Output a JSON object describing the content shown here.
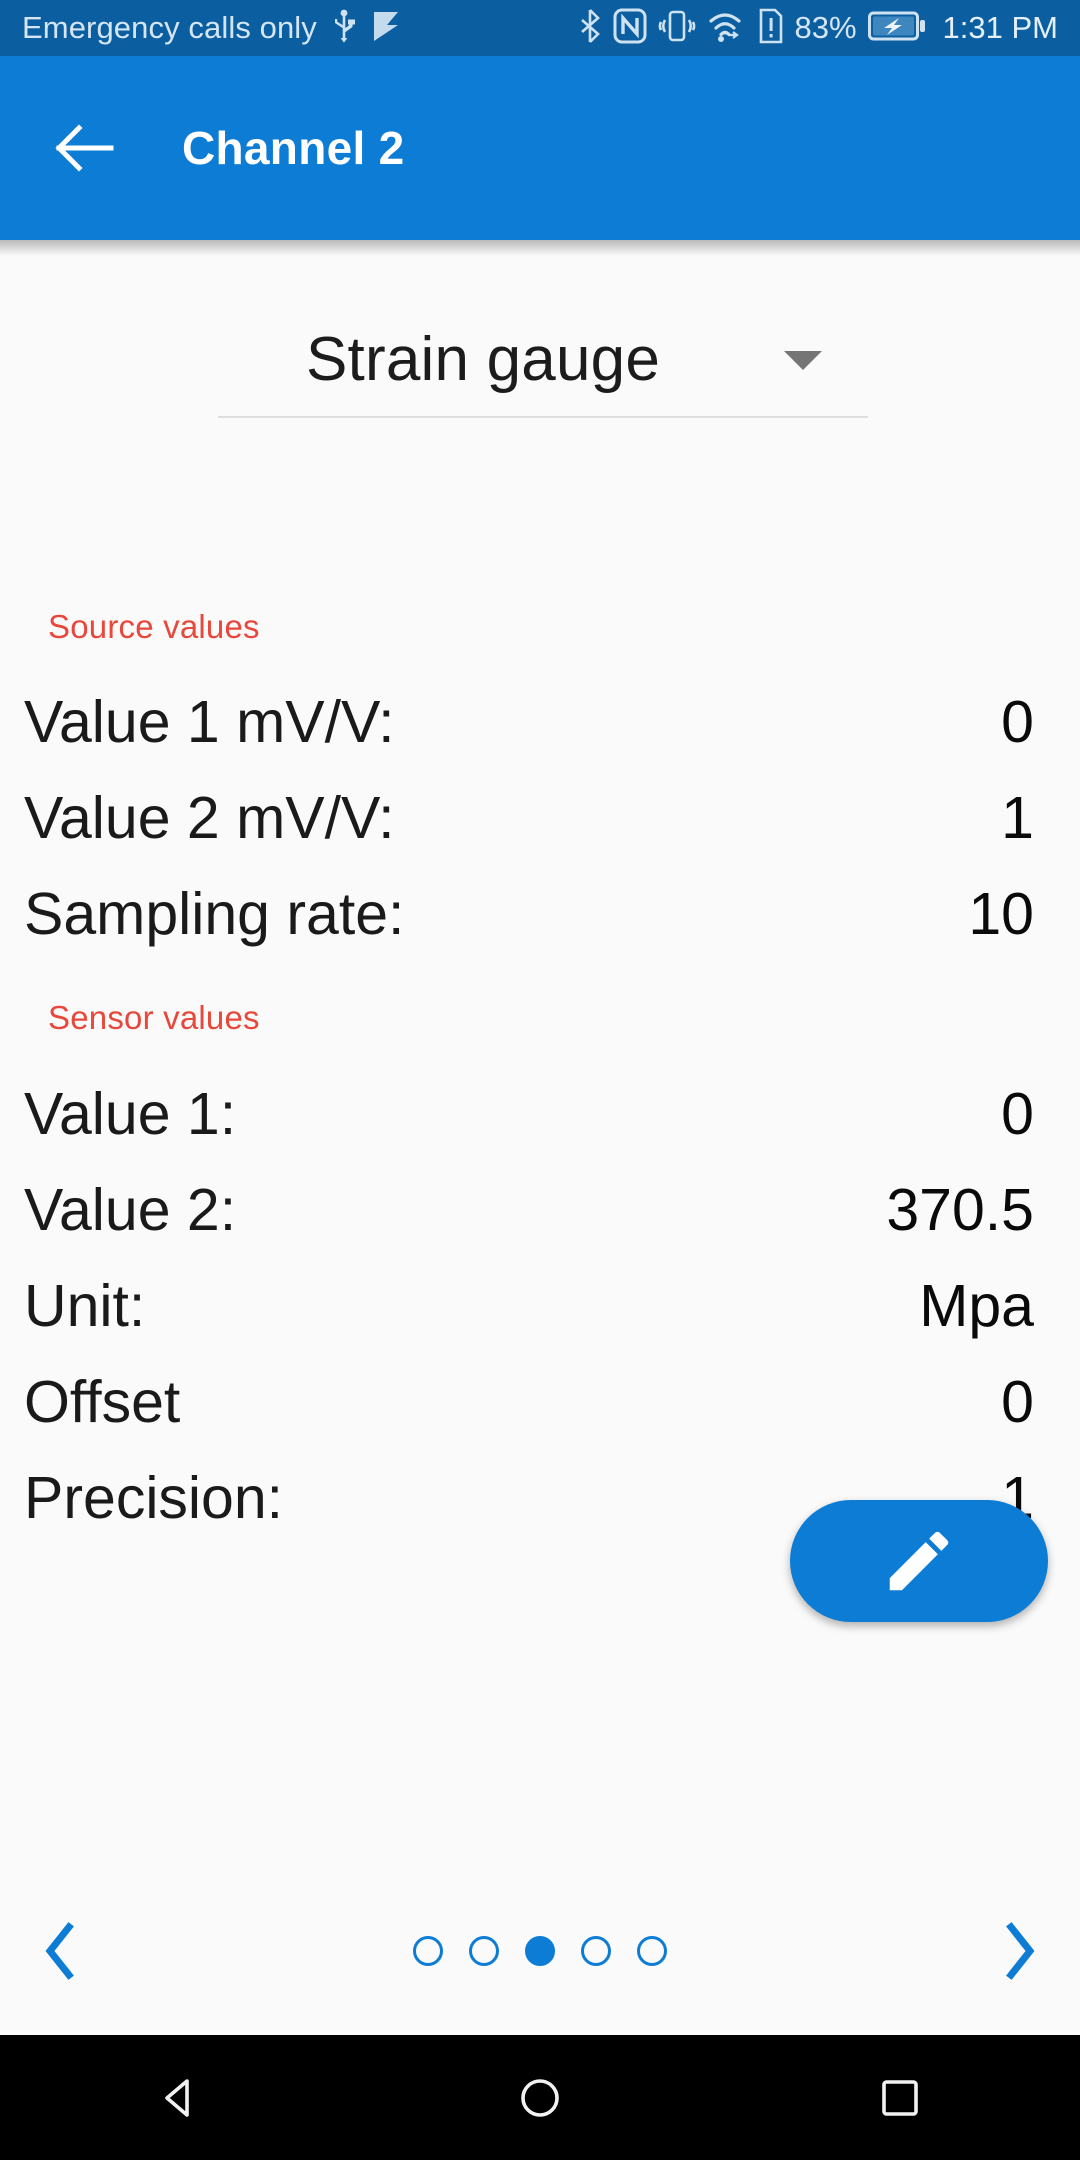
{
  "statusbar": {
    "carrier": "Emergency calls only",
    "battery_percent": "83%",
    "time": "1:31 PM",
    "icons": {
      "usb": "usb-icon",
      "flag": "flag-icon",
      "bluetooth": "bluetooth-icon",
      "nfc": "nfc-icon",
      "vibrate": "vibrate-icon",
      "wifi": "wifi-icon",
      "sim_alert": "sim-alert-icon",
      "battery": "battery-charging-icon"
    },
    "bg_color": "#0B5EA0",
    "fg_color": "#D5E5F3"
  },
  "appbar": {
    "title": "Channel 2",
    "back_icon": "arrow-left-icon",
    "bg_color": "#0C7CD5"
  },
  "sensor_type": {
    "selected": "Strain gauge",
    "caret_icon": "chevron-down-icon"
  },
  "sections": [
    {
      "title": "Source values",
      "color": "#E8483C",
      "rows": [
        {
          "label": "Value 1 mV/V:",
          "value": "0"
        },
        {
          "label": "Value 2 mV/V:",
          "value": "1"
        },
        {
          "label": "Sampling rate:",
          "value": "10"
        }
      ]
    },
    {
      "title": "Sensor values",
      "color": "#E8483C",
      "rows": [
        {
          "label": "Value 1:",
          "value": "0"
        },
        {
          "label": "Value 2:",
          "value": "370.5"
        },
        {
          "label": "Unit:",
          "value": "Mpa"
        },
        {
          "label": "Offset",
          "value": "0"
        },
        {
          "label": "Precision:",
          "value": "1"
        }
      ]
    }
  ],
  "fab": {
    "icon": "pencil-edit-icon",
    "color": "#0C7CD5"
  },
  "pager": {
    "prev_icon": "chevron-left-icon",
    "next_icon": "chevron-right-icon",
    "total_pages": 5,
    "current_page": 3,
    "accent_color": "#0C7CD5"
  },
  "navbar": {
    "back_icon": "triangle-back-icon",
    "home_icon": "circle-home-icon",
    "recents_icon": "square-recents-icon"
  }
}
